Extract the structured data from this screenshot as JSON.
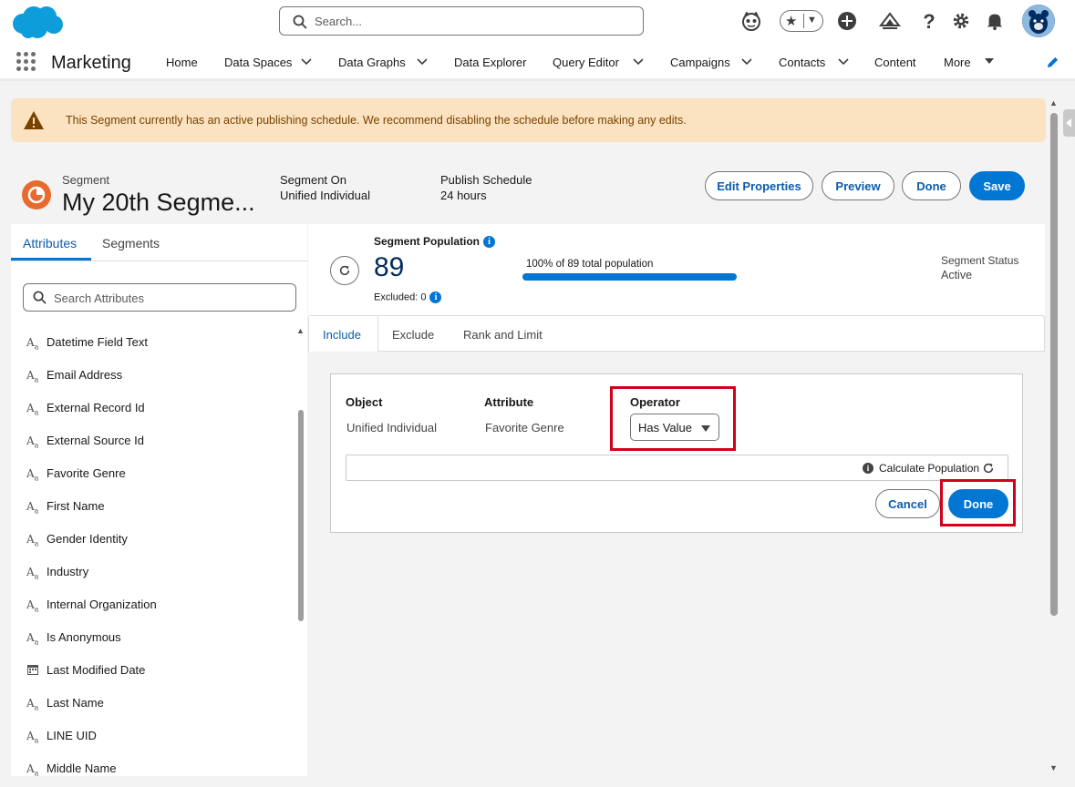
{
  "header": {
    "search_placeholder": "Search...",
    "icons": [
      "salesforce-logo",
      "agent-icon",
      "favorites-star-icon",
      "add-icon",
      "trailhead-icon",
      "help-icon",
      "setup-gear-icon",
      "notifications-bell-icon",
      "user-avatar"
    ]
  },
  "nav": {
    "app_name": "Marketing",
    "items": [
      {
        "label": "Home",
        "has_menu": false
      },
      {
        "label": "Data Spaces",
        "has_menu": true
      },
      {
        "label": "Data Graphs",
        "has_menu": true
      },
      {
        "label": "Data Explorer",
        "has_menu": false
      },
      {
        "label": "Query Editor",
        "has_menu": true
      },
      {
        "label": "Campaigns",
        "has_menu": true
      },
      {
        "label": "Contacts",
        "has_menu": true
      },
      {
        "label": "Content",
        "has_menu": false
      }
    ],
    "more_label": "More"
  },
  "alert": {
    "message": "This Segment currently has an active publishing schedule. We recommend disabling the schedule before making any edits."
  },
  "segment": {
    "type_label": "Segment",
    "name": "My 20th Segme...",
    "segment_on_label": "Segment On",
    "segment_on_value": "Unified Individual",
    "publish_schedule_label": "Publish Schedule",
    "publish_schedule_value": "24 hours",
    "buttons": {
      "edit_properties": "Edit Properties",
      "preview": "Preview",
      "done": "Done",
      "save": "Save"
    }
  },
  "left_panel": {
    "tabs": [
      "Attributes",
      "Segments"
    ],
    "active_tab": "Attributes",
    "search_placeholder": "Search Attributes",
    "attributes": [
      {
        "label": "Datetime Field Text",
        "icon": "text"
      },
      {
        "label": "Email Address",
        "icon": "text"
      },
      {
        "label": "External Record Id",
        "icon": "text"
      },
      {
        "label": "External Source Id",
        "icon": "text"
      },
      {
        "label": "Favorite Genre",
        "icon": "text"
      },
      {
        "label": "First Name",
        "icon": "text"
      },
      {
        "label": "Gender Identity",
        "icon": "text"
      },
      {
        "label": "Industry",
        "icon": "text"
      },
      {
        "label": "Internal Organization",
        "icon": "text"
      },
      {
        "label": "Is Anonymous",
        "icon": "text"
      },
      {
        "label": "Last Modified Date",
        "icon": "date"
      },
      {
        "label": "Last Name",
        "icon": "text"
      },
      {
        "label": "LINE UID",
        "icon": "text"
      },
      {
        "label": "Middle Name",
        "icon": "text"
      }
    ]
  },
  "population": {
    "label": "Segment Population",
    "count": "89",
    "excluded": "Excluded: 0",
    "bar_label": "100% of 89 total population",
    "bar_fraction": 1.0,
    "status_label": "Segment Status",
    "status_value": "Active"
  },
  "main_tabs": {
    "items": [
      "Include",
      "Exclude",
      "Rank and Limit"
    ],
    "active": "Include"
  },
  "rule_card": {
    "object_label": "Object",
    "object_value": "Unified Individual",
    "attribute_label": "Attribute",
    "attribute_value": "Favorite Genre",
    "operator_label": "Operator",
    "operator_value": "Has Value",
    "calculate_label": "Calculate Population",
    "cancel_label": "Cancel",
    "done_label": "Done"
  },
  "colors": {
    "brand": "#0176d3",
    "alert_bg": "#fbe2c0",
    "highlight": "#d0021b",
    "segment_icon": "#e96a2e"
  }
}
